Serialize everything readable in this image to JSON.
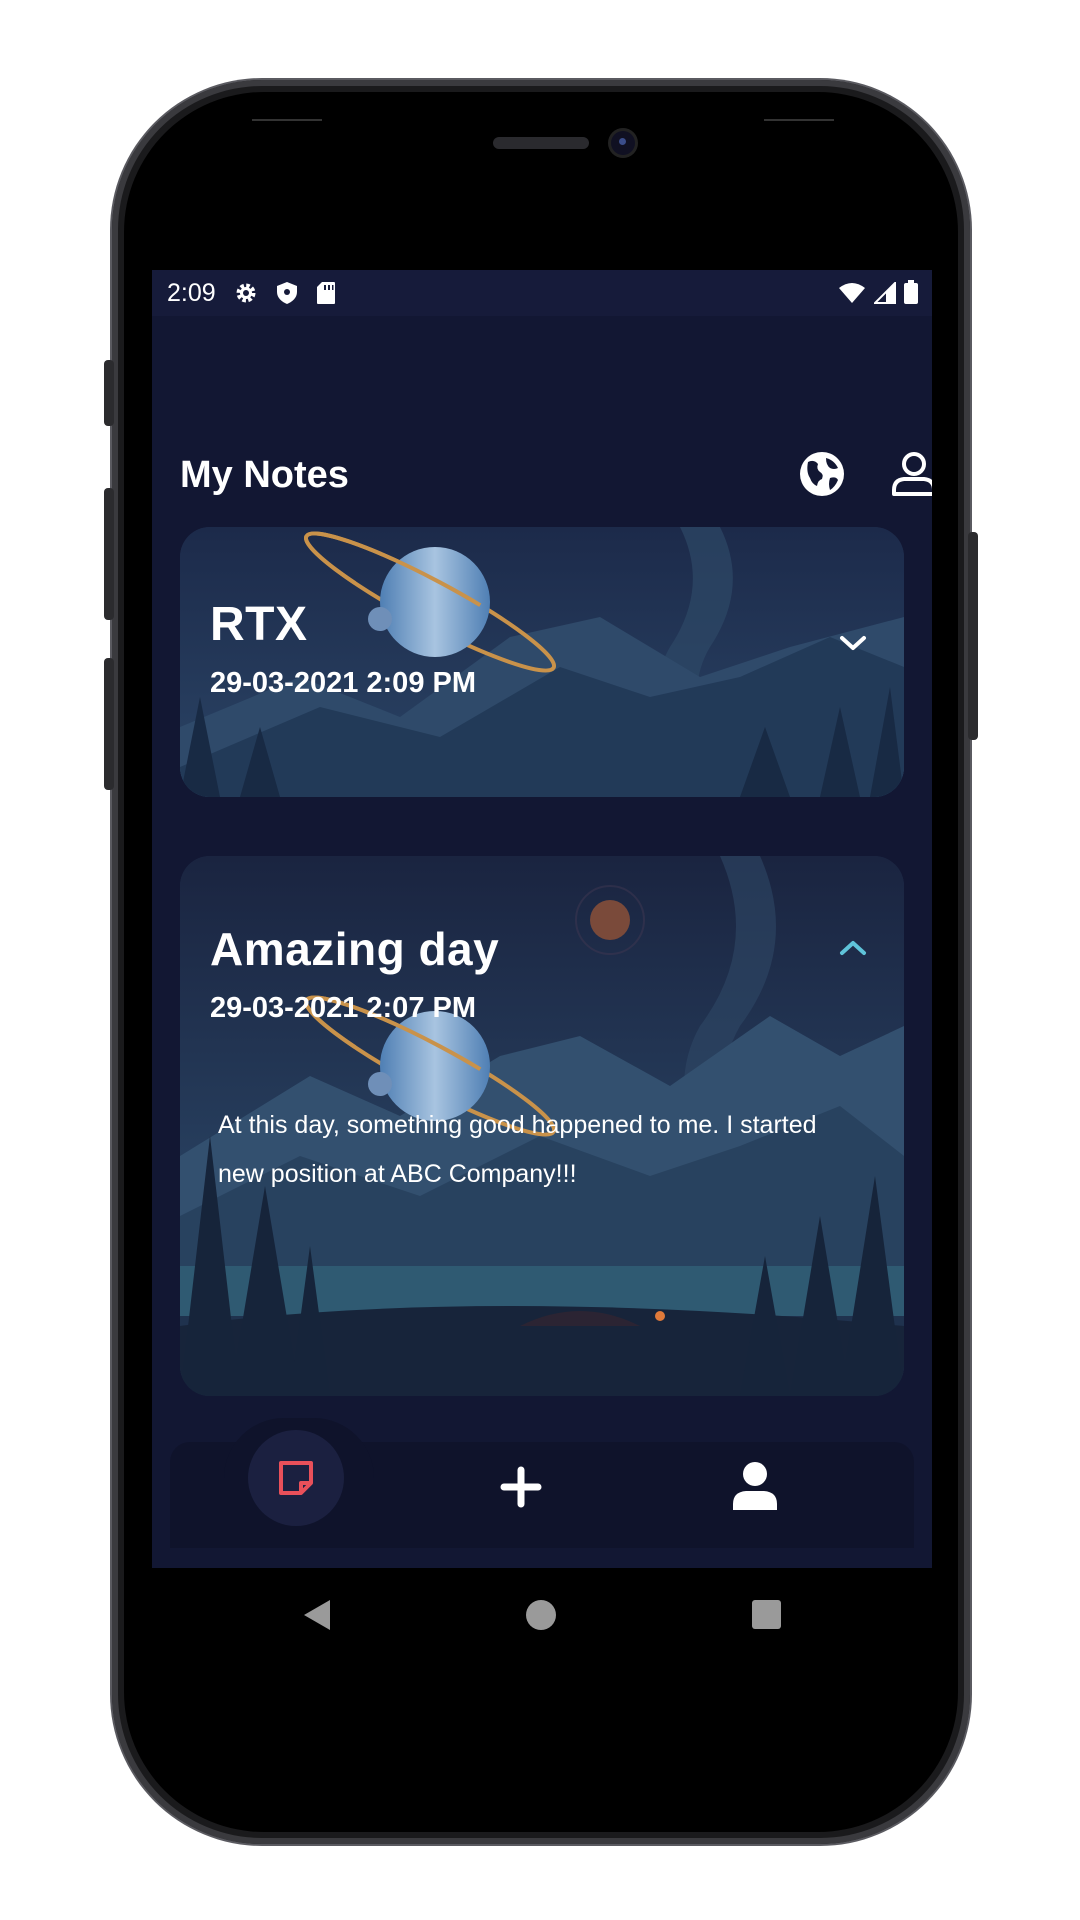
{
  "statusbar": {
    "time": "2:09",
    "left_icons": [
      "gear-icon",
      "shield-icon",
      "sd-card-icon"
    ],
    "right_icons": [
      "wifi-icon",
      "signal-icon",
      "battery-icon"
    ]
  },
  "header": {
    "title": "My Notes",
    "actions": [
      "globe-icon",
      "profile-icon"
    ]
  },
  "notes": [
    {
      "title": "RTX",
      "date": "29-03-2021 2:09 PM",
      "expanded": false,
      "body": ""
    },
    {
      "title": "Amazing day",
      "date": "29-03-2021 2:07 PM",
      "expanded": true,
      "body": "At this day, something good happened to me. I started new position at ABC Company!!!"
    }
  ],
  "bottom_nav": {
    "items": [
      "notes-icon",
      "add-icon",
      "user-icon"
    ],
    "active": "notes-icon"
  },
  "colors": {
    "screen_bg": "#121733",
    "accent_red": "#e9505a",
    "chevron_teal": "#5fc3d9"
  },
  "system_nav": [
    "back-icon",
    "home-icon",
    "recents-icon"
  ]
}
